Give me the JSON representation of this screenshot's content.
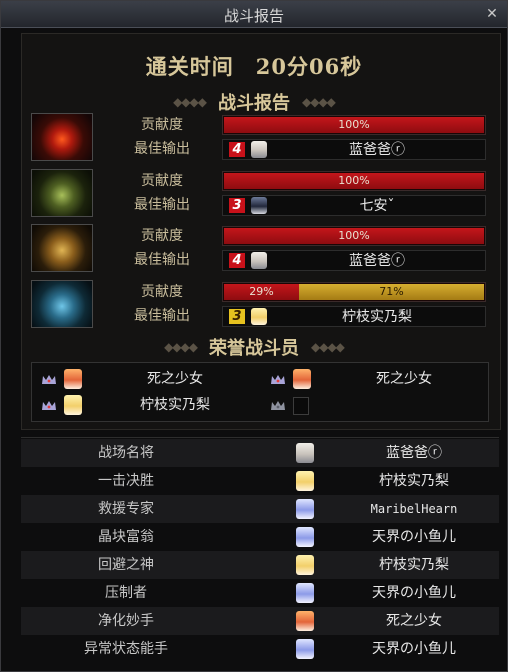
{
  "window": {
    "title": "战斗报告",
    "close_label": "✕"
  },
  "clear_time": "通关时间　20分06秒",
  "section_report": "战斗报告",
  "section_honor": "荣誉战斗员",
  "labels": {
    "contribution": "贡献度",
    "best_output": "最佳输出"
  },
  "members": [
    {
      "icon": "red-phoenix-portrait",
      "contribution_pct": 100,
      "contribution_text": "100%",
      "rank": "4",
      "player": "蓝爸爸ⓡ"
    },
    {
      "icon": "green-mech-portrait",
      "contribution_pct": 100,
      "contribution_text": "100%",
      "rank": "3",
      "player": "七安ˇ"
    },
    {
      "icon": "gold-mech-portrait",
      "contribution_pct": 100,
      "contribution_text": "100%",
      "rank": "4",
      "player": "蓝爸爸ⓡ"
    },
    {
      "icon": "blue-mech-portrait",
      "contribution_pct": 29,
      "contribution_text": "29%",
      "secondary_pct": 71,
      "secondary_text": "71%",
      "rank": "3",
      "player": "柠枝实乃梨"
    }
  ],
  "honor": [
    {
      "name": "死之少女",
      "icon": "crown-icon"
    },
    {
      "name": "死之少女",
      "icon": "crown-icon"
    },
    {
      "name": "柠枝实乃梨",
      "icon": "crown-icon"
    },
    {
      "name": "",
      "icon": "crown-icon"
    }
  ],
  "titles": [
    {
      "title": "战场名将",
      "player": "蓝爸爸ⓡ"
    },
    {
      "title": "一击决胜",
      "player": "柠枝实乃梨"
    },
    {
      "title": "救援专家",
      "player": "MaribelHearn"
    },
    {
      "title": "晶块富翁",
      "player": "天界の小鱼儿"
    },
    {
      "title": "回避之神",
      "player": "柠枝实乃梨"
    },
    {
      "title": "压制者",
      "player": "天界の小鱼儿"
    },
    {
      "title": "净化妙手",
      "player": "死之少女"
    },
    {
      "title": "异常状态能手",
      "player": "天界の小鱼儿"
    }
  ],
  "colors": {
    "contribution_bar": "#b5121a",
    "secondary_bar": "#c79a22",
    "rank_red": "#c8111a",
    "rank_yellow": "#e6c21f",
    "gold_text": "#d7c79a"
  }
}
